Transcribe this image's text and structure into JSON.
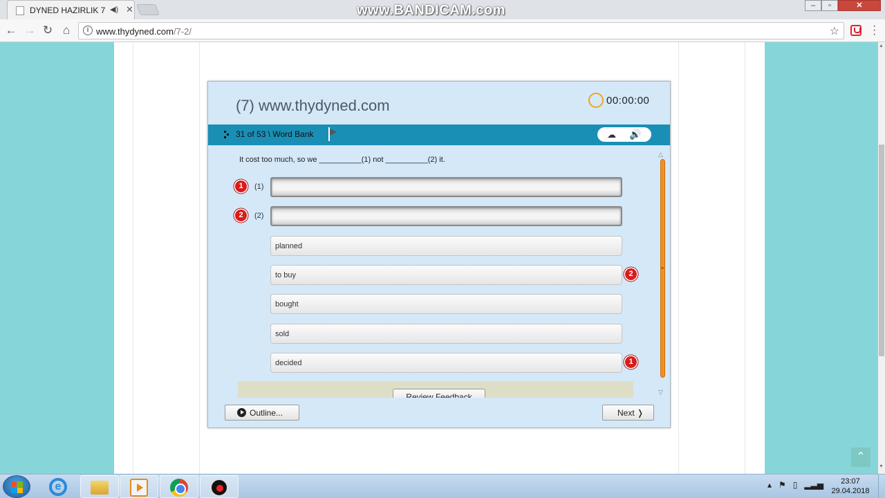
{
  "browser": {
    "tab_title": "DYNED HAZIRLIK 7",
    "watermark": "www.BANDICAM.com",
    "url_host": "www.thydyned.com",
    "url_path": "/7-2/"
  },
  "app": {
    "title": "(7) www.thydyned.com",
    "timer": "00:00:00",
    "breadcrumb": "31 of 53 \\ Word Bank",
    "prompt": "It cost too much, so we  __________(1) not  __________(2) it.",
    "slots": [
      {
        "badge": "1",
        "label": "(1)",
        "value": ""
      },
      {
        "badge": "2",
        "label": "(2)",
        "value": ""
      }
    ],
    "words": [
      {
        "text": "planned",
        "badge": ""
      },
      {
        "text": "to buy",
        "badge": "2"
      },
      {
        "text": "bought",
        "badge": ""
      },
      {
        "text": "sold",
        "badge": ""
      },
      {
        "text": "decided",
        "badge": "1"
      }
    ],
    "review_feedback": "Review Feedback",
    "outline_label": "Outline...",
    "next_label": "Next ❭"
  },
  "taskbar": {
    "time": "23:07",
    "date": "29.04.2018"
  },
  "colors": {
    "page_bg": "#86d6d9",
    "app_bg": "#d4e8f8",
    "app_bar": "#1a8fb6",
    "badge_red": "#d81c1c",
    "scroll_orange": "#f5901e",
    "timer_ring": "#f2a51a"
  },
  "icons": [
    "back-icon",
    "forward-icon",
    "reload-icon",
    "home-icon",
    "info-icon",
    "star-icon",
    "extension-icon",
    "menu-icon",
    "flag-icon",
    "hint-icon",
    "speaker-icon",
    "play-icon"
  ]
}
